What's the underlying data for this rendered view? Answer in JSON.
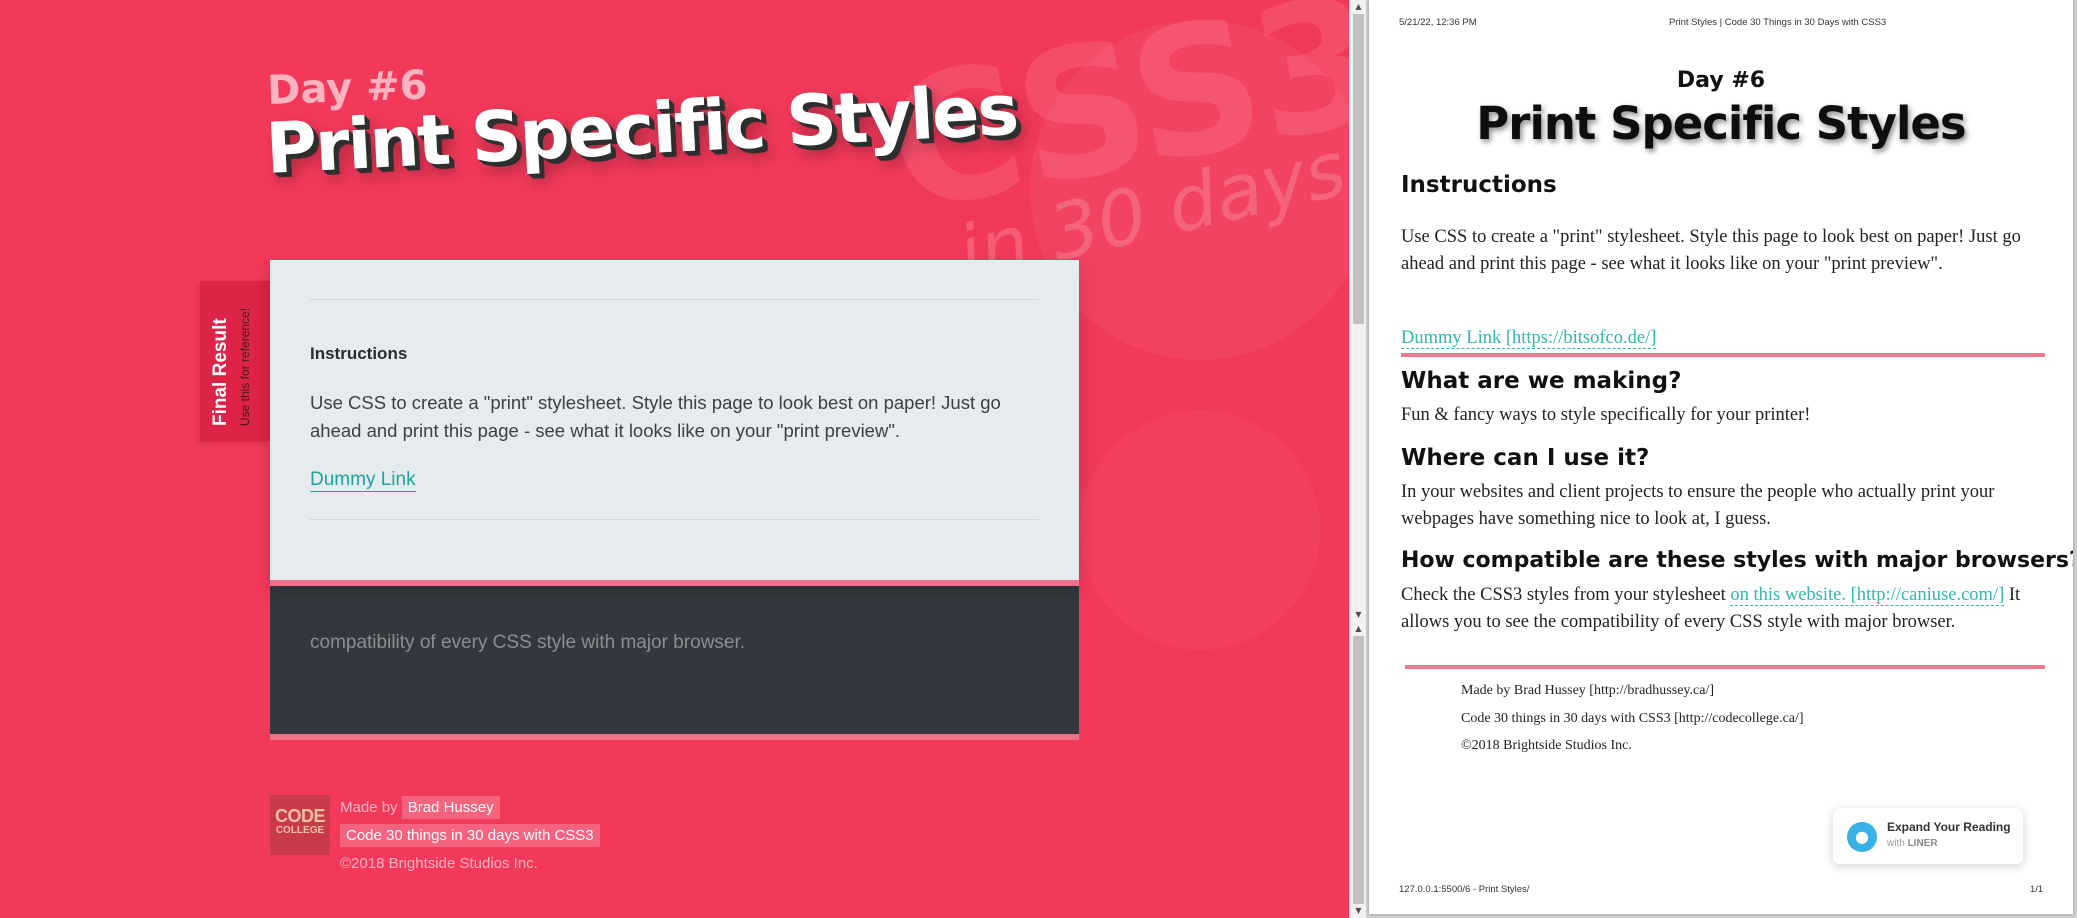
{
  "web": {
    "background_watermark": {
      "css3": "CSS3",
      "days": "in 30 days"
    },
    "day_kicker": "Day #6",
    "title": "Print Specific Styles",
    "side_tab": {
      "label": "Final Result",
      "sublabel": "Use this for reference!"
    },
    "card": {
      "heading": "Instructions",
      "body": "Use CSS to create a \"print\" stylesheet. Style this page to look best on paper! Just go ahead and print this page - see what it looks like on your \"print preview\".",
      "link": "Dummy Link"
    },
    "dark_card": {
      "text": "compatibility of every CSS style with major browser."
    },
    "footer": {
      "logo_line1": "CODE",
      "logo_line2": "COLLEGE",
      "made_by_prefix": "Made by",
      "author": "Brad Hussey",
      "course": "Code 30 things in 30 days with CSS3",
      "copyright": "©2018 Brightside Studios Inc."
    }
  },
  "scrollbar": {
    "up": "▲",
    "down": "▼"
  },
  "print_preview": {
    "header_datetime": "5/21/22, 12:36 PM",
    "header_title": "Print Styles | Code 30 Things in 30 Days with CSS3",
    "day": "Day #6",
    "title": "Print Specific Styles",
    "instructions_heading": "Instructions",
    "instructions_body": "Use CSS to create a \"print\" stylesheet. Style this page to look best on paper! Just go ahead and print this page - see what it looks like on your \"print preview\".",
    "dummy_link": "Dummy Link [https://bitsofco.de/]",
    "q1_heading": "What are we making?",
    "q1_body": "Fun & fancy ways to style specifically for your printer!",
    "q2_heading": "Where can I use it?",
    "q2_body": "In your websites and client projects to ensure the people who actually print your webpages have something nice to look at, I guess.",
    "q3_heading": "How compatible are these styles with major browsers?",
    "q3_body_before": "Check the CSS3 styles from your stylesheet ",
    "q3_link": "on this website. [http://caniuse.com/]",
    "q3_body_after": " It allows you to see the compatibility of every CSS style with major browser.",
    "footer_line1": "Made by Brad Hussey [http://bradhussey.ca/]",
    "footer_line2": "Code 30 things in 30 days with CSS3 [http://codecollege.ca/]",
    "footer_line3": "©2018 Brightside Studios Inc.",
    "footer_url": "127.0.0.1:5500/6 - Print Styles/",
    "page_number": "1/1"
  },
  "liner": {
    "title": "Expand Your Reading",
    "with": "with",
    "brand": "LINER",
    "icon": "lightbulb-icon"
  },
  "colors": {
    "brand_red": "#f3395a",
    "accent_teal": "#1aa59c",
    "accent_pink": "#f0718a",
    "dark_card": "#34373d",
    "light_card": "#e6ebef"
  }
}
